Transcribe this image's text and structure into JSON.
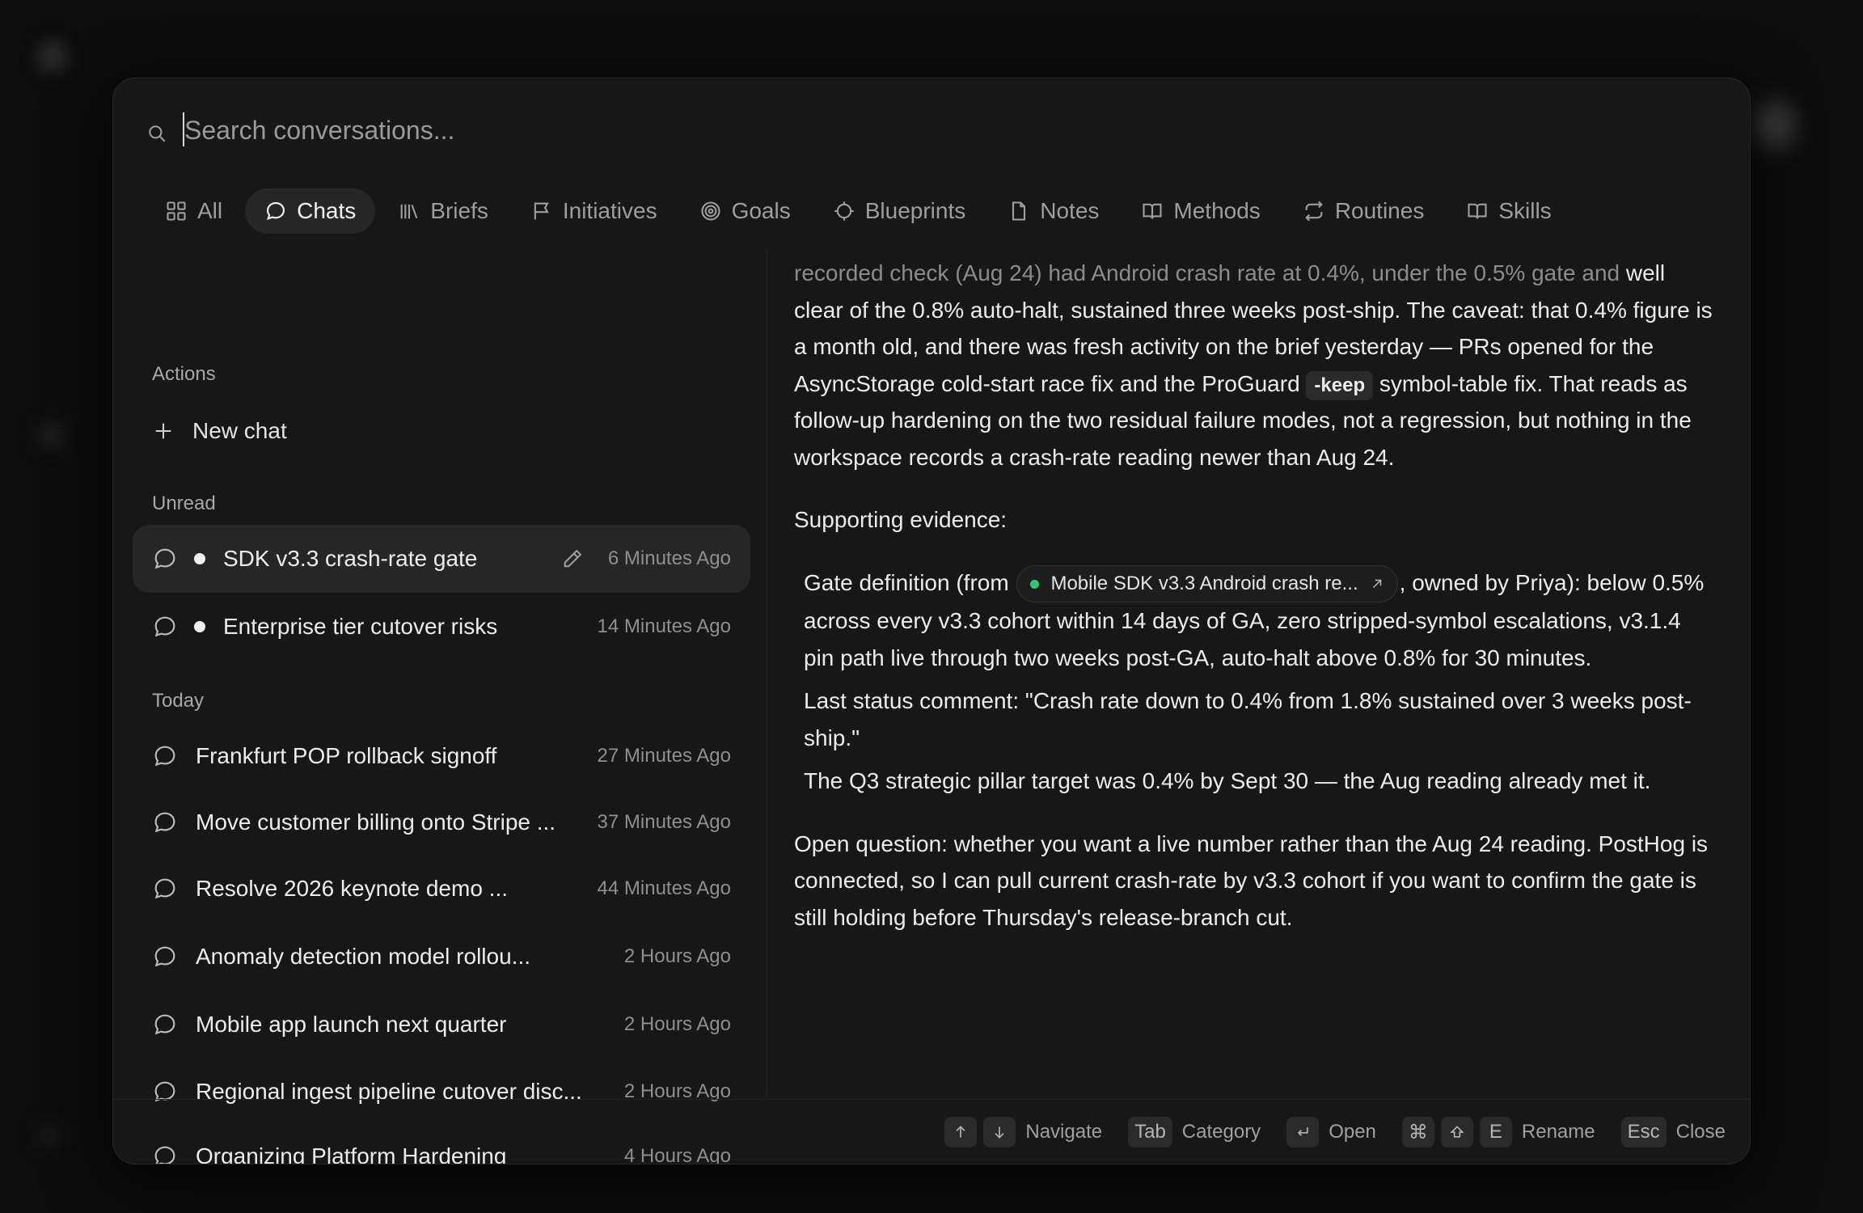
{
  "search": {
    "placeholder": "Search conversations..."
  },
  "tabs": [
    {
      "label": "All",
      "icon": "grid-icon"
    },
    {
      "label": "Chats",
      "icon": "chat-bubble-icon",
      "active": true
    },
    {
      "label": "Briefs",
      "icon": "library-icon"
    },
    {
      "label": "Initiatives",
      "icon": "flag-icon"
    },
    {
      "label": "Goals",
      "icon": "target-icon"
    },
    {
      "label": "Blueprints",
      "icon": "crosshair-icon"
    },
    {
      "label": "Notes",
      "icon": "note-icon"
    },
    {
      "label": "Methods",
      "icon": "book-open-icon"
    },
    {
      "label": "Routines",
      "icon": "repeat-icon"
    },
    {
      "label": "Skills",
      "icon": "book-icon"
    }
  ],
  "sidebar": {
    "actions_title": "Actions",
    "new_chat": "New chat",
    "unread_title": "Unread",
    "unread": [
      {
        "title": "SDK v3.3 crash-rate gate",
        "time": "6 Minutes Ago"
      },
      {
        "title": "Enterprise tier cutover risks",
        "time": "14 Minutes Ago"
      }
    ],
    "today_title": "Today",
    "today": [
      {
        "title": "Frankfurt POP rollback signoff",
        "time": "27 Minutes Ago"
      },
      {
        "title": "Move customer billing onto Stripe ...",
        "time": "37 Minutes Ago"
      },
      {
        "title": "Resolve 2026 keynote demo ...",
        "time": "44 Minutes Ago"
      },
      {
        "title": "Anomaly detection model rollou...",
        "time": "2 Hours Ago"
      },
      {
        "title": "Mobile app launch next quarter",
        "time": "2 Hours Ago"
      },
      {
        "title": "Regional ingest pipeline cutover disc...",
        "time": "2 Hours Ago"
      },
      {
        "title": "Organizing Platform Hardening",
        "time": "4 Hours Ago"
      }
    ]
  },
  "preview": {
    "p1_faded": "recorded check (Aug 24) had Android crash rate at 0.4%, under the 0.5% gate and",
    "p1_a": "well clear of the 0.8% auto-halt, sustained three weeks post-ship. The caveat: that 0.4% figure is a month old, and there was fresh activity on the brief yesterday — PRs opened for the AsyncStorage cold-start race fix and the ProGuard",
    "p1_code": "-keep",
    "p1_b": "symbol-table fix. That reads as follow-up hardening on the two residual failure modes, not a regression, but nothing in the workspace records a crash-rate reading newer than Aug 24.",
    "supporting": "Supporting evidence:",
    "ev1_a": "Gate definition (from",
    "ev1_link": "Mobile SDK v3.3 Android crash re...",
    "ev1_b": ", owned by Priya): below 0.5% across every v3.3 cohort within 14 days of GA, zero stripped-symbol escalations, v3.1.4 pin path live through two weeks post-GA, auto-halt above 0.8% for 30 minutes.",
    "ev2": "Last status comment: \"Crash rate down to 0.4% from 1.8% sustained over 3 weeks post-ship.\"",
    "ev3": "The Q3 strategic pillar target was 0.4% by Sept 30 — the Aug reading already met it.",
    "open_q": "Open question: whether you want a live number rather than the Aug 24 reading. PostHog is connected, so I can pull current crash-rate by v3.3 cohort if you want to confirm the gate is still holding before Thursday's release-branch cut."
  },
  "footer": {
    "navigate": "Navigate",
    "tab_key": "Tab",
    "category": "Category",
    "open": "Open",
    "cmd_key": "⌘",
    "e_key": "E",
    "rename": "Rename",
    "esc_key": "Esc",
    "close": "Close"
  },
  "colors": {
    "accent_green": "#2ecc71",
    "modal_bg": "#171717",
    "selected_bg": "#262626"
  }
}
